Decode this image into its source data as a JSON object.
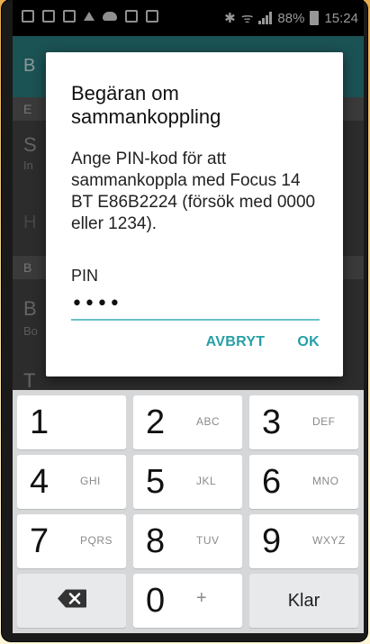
{
  "status_bar": {
    "battery_percent": "88%",
    "time": "15:24"
  },
  "background": {
    "letters": [
      "B",
      "E",
      "S",
      "In",
      "H",
      "B",
      "B",
      "Bo",
      "T"
    ]
  },
  "dialog": {
    "title": "Begäran om sammankoppling",
    "message": "Ange PIN-kod för att sammankoppla med Focus 14 BT E86B2224 (försök med 0000 eller 1234).",
    "pin_label": "PIN",
    "pin_value": "••••",
    "cancel_label": "AVBRYT",
    "ok_label": "OK",
    "accent_color": "#259fa6"
  },
  "keypad": {
    "keys": [
      {
        "digit": "1",
        "letters": ""
      },
      {
        "digit": "2",
        "letters": "ABC"
      },
      {
        "digit": "3",
        "letters": "DEF"
      },
      {
        "digit": "4",
        "letters": "GHI"
      },
      {
        "digit": "5",
        "letters": "JKL"
      },
      {
        "digit": "6",
        "letters": "MNO"
      },
      {
        "digit": "7",
        "letters": "PQRS"
      },
      {
        "digit": "8",
        "letters": "TUV"
      },
      {
        "digit": "9",
        "letters": "WXYZ"
      }
    ],
    "zero": "0",
    "zero_secondary": "+",
    "done_label": "Klar",
    "backspace_icon": "backspace-icon"
  }
}
